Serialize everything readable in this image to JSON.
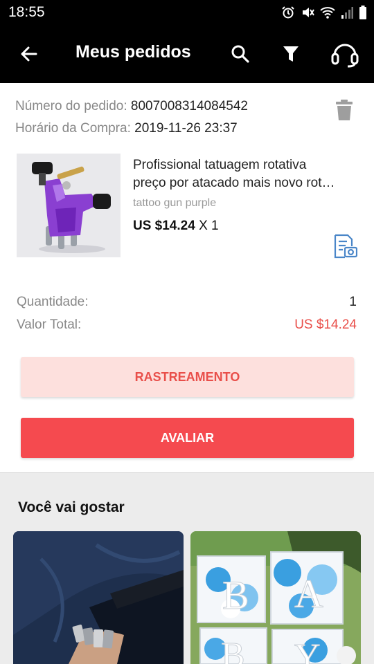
{
  "status_bar": {
    "time": "18:55"
  },
  "app_bar": {
    "title": "Meus pedidos"
  },
  "order": {
    "number_label": "Número do pedido:",
    "number_value": "8007008314084542",
    "time_label": "Horário da Compra:",
    "time_value": "2019-11-26 23:37",
    "product": {
      "title_line1": "Profissional tatuagem rotativa",
      "title_line2": "preço por atacado mais novo rot…",
      "variant": "tattoo gun purple",
      "price": "US $14.24",
      "qty": "X 1"
    },
    "summary": {
      "quantity_label": "Quantidade:",
      "quantity_value": "1",
      "total_label": "Valor Total:",
      "total_value": "US $14.24"
    },
    "buttons": {
      "tracking": "RASTREAMENTO",
      "rate": "AVALIAR"
    }
  },
  "recommendations": {
    "title": "Você vai gostar"
  },
  "icons": [
    "back-arrow-icon",
    "search-icon",
    "filter-icon",
    "headset-icon",
    "trash-icon",
    "document-camera-icon"
  ],
  "colors": {
    "accent": "#f54a4f",
    "accent_light": "#fde0dd",
    "price_red": "#e94f4a"
  }
}
